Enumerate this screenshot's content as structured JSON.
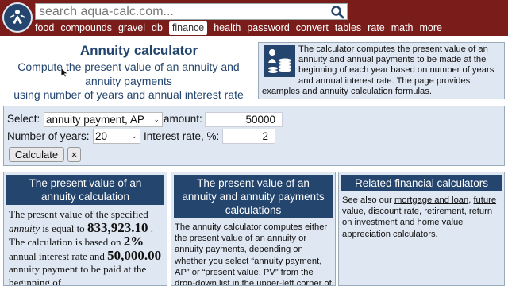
{
  "header": {
    "search_placeholder": "search aqua-calc.com...",
    "nav": [
      "food",
      "compounds",
      "gravel",
      "db",
      "finance",
      "health",
      "password",
      "convert",
      "tables",
      "rate",
      "math",
      "more"
    ],
    "active_nav": "finance"
  },
  "hero": {
    "title": "Annuity calculator",
    "subtitle_line1": "Compute the present value of an annuity and annuity payments",
    "subtitle_line2": "using number of years and annual interest rate"
  },
  "intro": {
    "text": "The calculator computes the present value of an annuity and annual payments to be made at the beginning of each year based on number of years and annual interest rate. The page provides examples and annuity calculation formulas."
  },
  "form": {
    "select_label": "Select:",
    "select_value": "annuity payment, AP",
    "amount_label": "amount:",
    "amount_value": "50000",
    "years_label": "Number of years:",
    "years_value": "20",
    "rate_label": "Interest rate, %:",
    "rate_value": "2",
    "calculate_label": "Calculate",
    "clear_label": "×"
  },
  "panel1": {
    "title": "The present value of an annuity calculation",
    "t1": "The present value of the specified",
    "t2_em": "annuity",
    "t2": " is equal to",
    "pv": "833,923.10",
    "t3": " . The calculation is based on ",
    "rate": "2%",
    "t4": " annual interest rate and ",
    "payment": "50,000.00",
    "t5": " annuity payment to be paid at the beginning of"
  },
  "panel2": {
    "title": "The present value of an annuity and annuity payments calculations",
    "text": "The annuity calculator computes either the present value of an annuity or annuity payments, depending on whether you select “annuity payment, AP” or “present value, PV” from the drop-down list in the upper-left corner of"
  },
  "panel3": {
    "title": "Related financial calculators",
    "t_pre": "See also our ",
    "links": [
      "mortgage and loan",
      "future value",
      "discount rate",
      "retirement",
      "return on investment",
      "home value appreciation"
    ],
    "t_and": " and ",
    "t_post": " calculators."
  },
  "colors": {
    "header_bg": "#7a1c1a",
    "brand_blue": "#24456e",
    "panel_bg": "#dfe7f2"
  },
  "icons": {
    "logo": "aqua-calc-logo",
    "search": "search-icon",
    "intro": "coins-person-icon",
    "cursor": "mouse-pointer-icon"
  }
}
